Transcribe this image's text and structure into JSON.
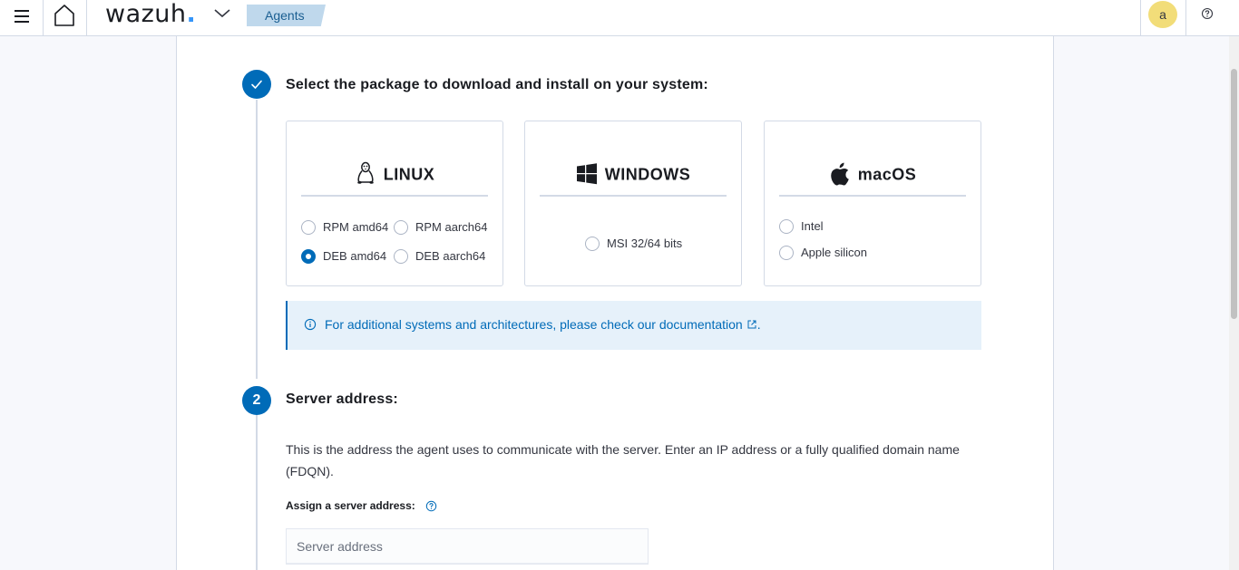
{
  "header": {
    "logo_text": "wazuh",
    "logo_dot": ".",
    "breadcrumb": "Agents",
    "user_initial": "a"
  },
  "step1": {
    "title": "Select the package to download and install on your system:",
    "cards": {
      "linux": {
        "label": "LINUX",
        "options": [
          {
            "label": "RPM amd64",
            "selected": false
          },
          {
            "label": "RPM aarch64",
            "selected": false
          },
          {
            "label": "DEB amd64",
            "selected": true
          },
          {
            "label": "DEB aarch64",
            "selected": false
          }
        ]
      },
      "windows": {
        "label": "WINDOWS",
        "options": [
          {
            "label": "MSI 32/64 bits",
            "selected": false
          }
        ]
      },
      "macos": {
        "label": "macOS",
        "options": [
          {
            "label": "Intel",
            "selected": false
          },
          {
            "label": "Apple silicon",
            "selected": false
          }
        ]
      }
    },
    "callout": {
      "text": "For additional systems and architectures, please check our documentation",
      "suffix": "."
    }
  },
  "step2": {
    "number": "2",
    "title": "Server address:",
    "description": "This is the address the agent uses to communicate with the server. Enter an IP address or a fully qualified domain name (FDQN).",
    "field_label": "Assign a server address:",
    "input_placeholder": "Server address",
    "input_value": ""
  },
  "colors": {
    "accent": "#006bb8",
    "callout_bg": "#e6f1fa",
    "avatar_bg": "#f2dd79",
    "breadcrumb_bg": "#bfd8ec"
  },
  "icons": {
    "menu": "hamburger-icon",
    "home": "home-icon",
    "chevron": "chevron-down-icon",
    "help": "question-circle-icon",
    "check": "check-icon",
    "linux": "linux-penguin-icon",
    "windows": "windows-logo-icon",
    "apple": "apple-logo-icon",
    "info": "info-circle-icon",
    "external": "external-link-icon"
  }
}
